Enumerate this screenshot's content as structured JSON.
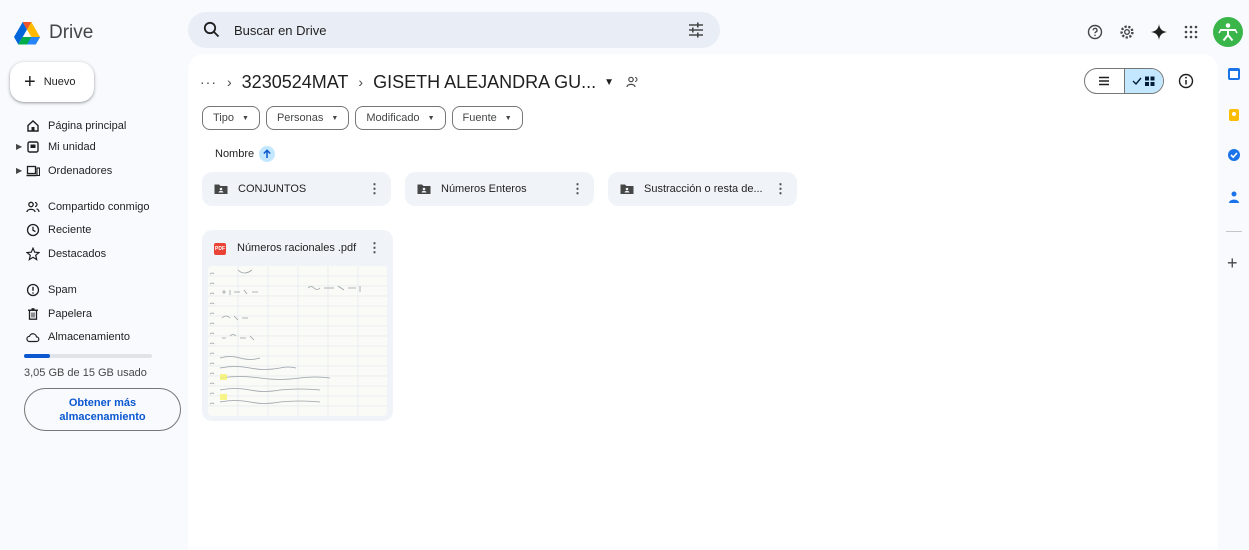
{
  "app": {
    "logo_text": "Drive"
  },
  "search": {
    "placeholder": "Buscar en Drive"
  },
  "sidebar": {
    "new_label": "Nuevo",
    "items": [
      {
        "label": "Página principal",
        "icon": "home-icon"
      },
      {
        "label": "Mi unidad",
        "icon": "my-drive-icon"
      },
      {
        "label": "Ordenadores",
        "icon": "computer-icon"
      },
      {
        "label": "Compartido conmigo",
        "icon": "shared-icon"
      },
      {
        "label": "Reciente",
        "icon": "clock-icon"
      },
      {
        "label": "Destacados",
        "icon": "star-icon"
      },
      {
        "label": "Spam",
        "icon": "spam-icon"
      },
      {
        "label": "Papelera",
        "icon": "trash-icon"
      },
      {
        "label": "Almacenamiento",
        "icon": "cloud-icon"
      }
    ],
    "storage": {
      "used_text": "3,05 GB de 15 GB usado",
      "used_fraction": 0.203,
      "get_more_line1": "Obtener más",
      "get_more_line2": "almacenamiento"
    }
  },
  "breadcrumb": {
    "dots": "···",
    "parent": "3230524MAT",
    "current": "GISETH ALEJANDRA GU..."
  },
  "filters": [
    "Tipo",
    "Personas",
    "Modificado",
    "Fuente"
  ],
  "sort": {
    "label": "Nombre"
  },
  "folders": [
    {
      "label": "CONJUNTOS"
    },
    {
      "label": "Números Enteros"
    },
    {
      "label": "Sustracción o resta de..."
    }
  ],
  "files": [
    {
      "label": "Números racionales .pdf",
      "type_badge": "PDF"
    }
  ],
  "colors": {
    "accent": "#0b57d0",
    "selected": "#c2e7ff",
    "folder_bg": "#f0f4f9",
    "surface": "#f8fafd"
  }
}
